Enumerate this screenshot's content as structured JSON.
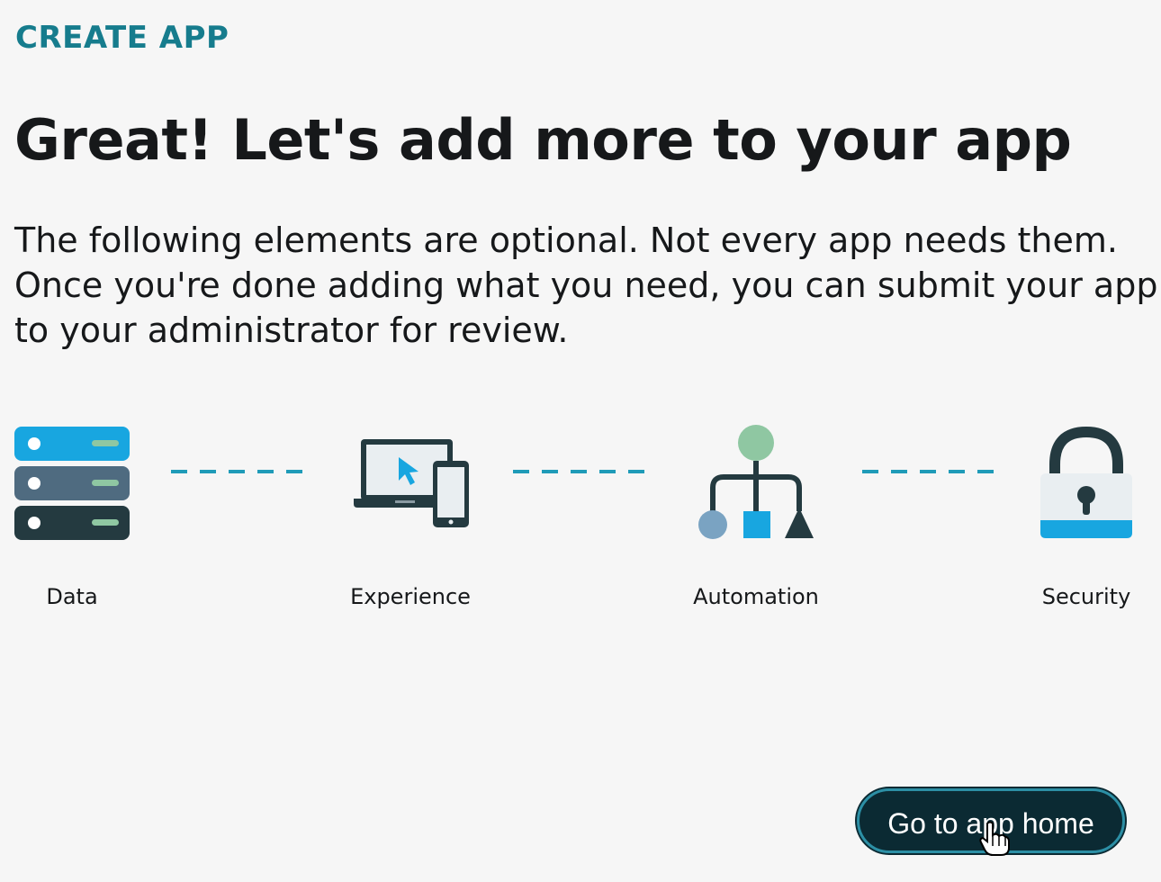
{
  "header": {
    "eyebrow": "CREATE APP",
    "title": "Great! Let's add more to your app",
    "description_lines": [
      "The following elements are optional. Not every app needs them.",
      "Once you're done adding what you need, you can submit your app",
      "to your administrator for review."
    ]
  },
  "steps": [
    {
      "label": "Data",
      "icon": "server-stack-icon"
    },
    {
      "label": "Experience",
      "icon": "laptop-phone-icon"
    },
    {
      "label": "Automation",
      "icon": "flow-tree-icon"
    },
    {
      "label": "Security",
      "icon": "padlock-icon"
    }
  ],
  "actions": {
    "primary_label": "Go to app home"
  },
  "colors": {
    "accent": "#167c8d",
    "button_bg": "#0b2a33",
    "button_border": "#2c8fa5",
    "connector": "#1f9bb8",
    "server_top": "#18a6e0",
    "server_mid": "#4f6b80",
    "server_bottom": "#243a40"
  }
}
